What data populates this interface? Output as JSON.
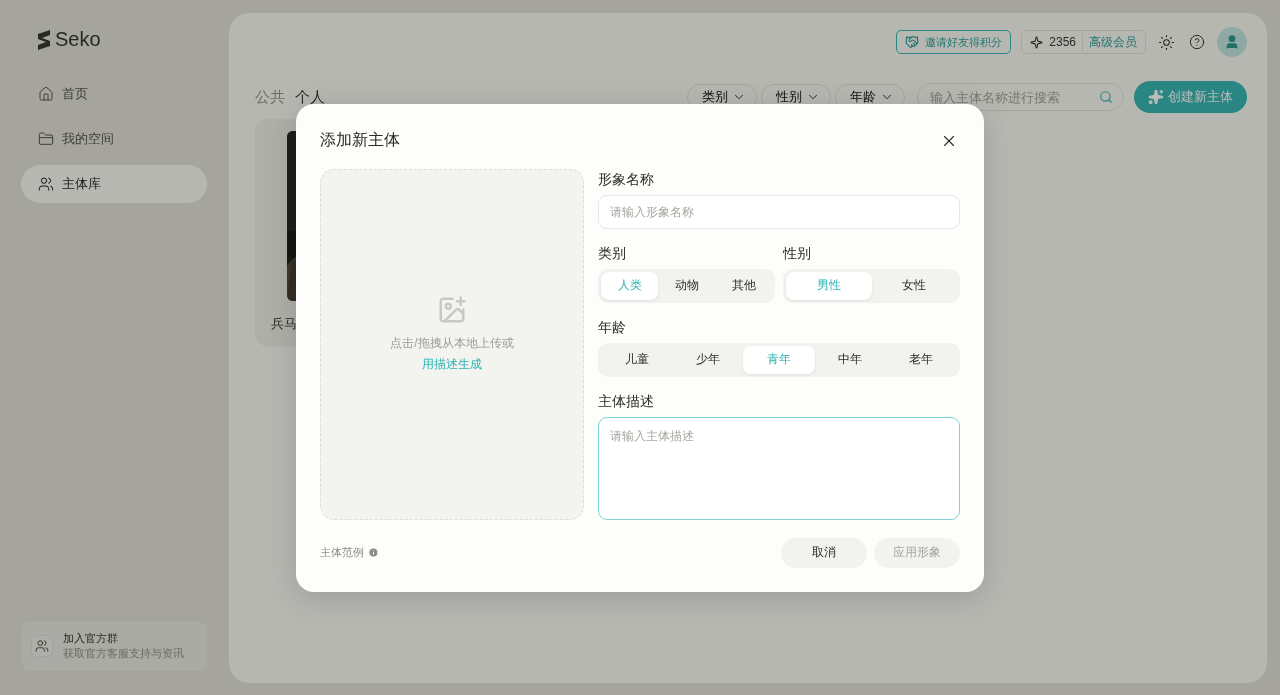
{
  "sidebar": {
    "logo": "Seko",
    "items": [
      {
        "label": "首页",
        "selected": false
      },
      {
        "label": "我的空间",
        "selected": false
      },
      {
        "label": "主体库",
        "selected": true
      }
    ],
    "footer": {
      "title": "加入官方群",
      "subtitle": "获取官方客服支持与资讯"
    }
  },
  "header": {
    "invite": "邀请好友得积分",
    "credits": "2356",
    "membership": "高级会员"
  },
  "tabs": [
    {
      "label": "公共",
      "selected": false
    },
    {
      "label": "个人",
      "selected": true
    }
  ],
  "filters": [
    "类别",
    "性别",
    "年龄"
  ],
  "search": {
    "placeholder": "输入主体名称进行搜索"
  },
  "create_button": "创建新主体",
  "cards": [
    {
      "name": "兵马"
    }
  ],
  "dialog": {
    "title": "添加新主体",
    "upload": {
      "text": "点击/拖拽从本地上传或",
      "link": "用描述生成"
    },
    "name_field": {
      "label": "形象名称",
      "placeholder": "请输入形象名称"
    },
    "category": {
      "label": "类别",
      "options": [
        {
          "label": "人类",
          "selected": true
        },
        {
          "label": "动物",
          "selected": false
        },
        {
          "label": "其他",
          "selected": false
        }
      ]
    },
    "gender": {
      "label": "性别",
      "options": [
        {
          "label": "男性",
          "selected": true
        },
        {
          "label": "女性",
          "selected": false
        }
      ]
    },
    "age": {
      "label": "年龄",
      "options": [
        {
          "label": "儿童",
          "selected": false
        },
        {
          "label": "少年",
          "selected": false
        },
        {
          "label": "青年",
          "selected": true
        },
        {
          "label": "中年",
          "selected": false
        },
        {
          "label": "老年",
          "selected": false
        }
      ]
    },
    "description": {
      "label": "主体描述",
      "placeholder": "请输入主体描述",
      "focused": true
    },
    "example": "主体范例",
    "buttons": [
      {
        "label": "取消",
        "disabled": false
      },
      {
        "label": "应用形象",
        "disabled": true
      }
    ]
  }
}
